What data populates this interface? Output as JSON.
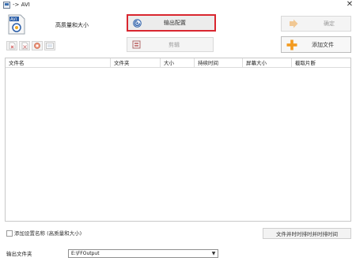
{
  "window": {
    "title": "-> AVI",
    "close_glyph": "✕"
  },
  "header": {
    "format_label": "高质量和大小",
    "format_icon": "avi-file-icon",
    "output_config_label": "输出配置",
    "ok_label": "确定",
    "edit_label": "剪辑",
    "add_file_label": "添加文件"
  },
  "toolbar": {
    "icons": [
      "remove-file-icon",
      "clear-list-icon",
      "stop-icon",
      "play-preview-icon"
    ]
  },
  "table": {
    "columns": [
      "文件名",
      "文件夹",
      "大小",
      "持续时间",
      "屏幕大小",
      "截取片断"
    ],
    "rows": []
  },
  "footer": {
    "add_setting_name_label": "添加设置名称 (高质量和大小)",
    "add_setting_name_checked": false,
    "merge_label": "文件并时时排时并时排时间",
    "output_folder_label": "输出文件夹",
    "output_folder_value": "E:\\FFOutput",
    "dropdown_glyph": "▼"
  },
  "colors": {
    "accent_border": "#d9262f",
    "add_icon": "#f39a1e"
  }
}
